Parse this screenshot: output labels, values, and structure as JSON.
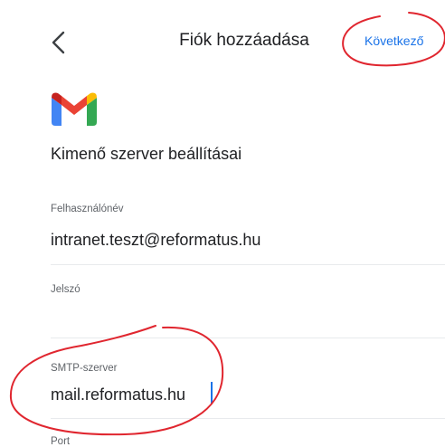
{
  "header": {
    "title": "Fiók hozzáadása",
    "next_label": "Következő",
    "back_icon": "chevron-left-icon"
  },
  "brand": {
    "logo_icon": "gmail-logo",
    "colors": {
      "blue": "#4285F4",
      "red": "#EA4335",
      "yellow": "#FBBC04",
      "green": "#34A853",
      "dark_red": "#C5221F"
    }
  },
  "page": {
    "heading": "Kimenő szerver beállításai"
  },
  "form": {
    "username": {
      "label": "Felhasználónév",
      "value": "intranet.teszt@reformatus.hu"
    },
    "password": {
      "label": "Jelszó",
      "value": ""
    },
    "smtp_server": {
      "label": "SMTP-szerver",
      "value": "mail.reformatus.hu"
    },
    "port": {
      "label": "Port"
    }
  },
  "colors": {
    "accent": "#1a73e8",
    "annotation": "#e0262f"
  }
}
